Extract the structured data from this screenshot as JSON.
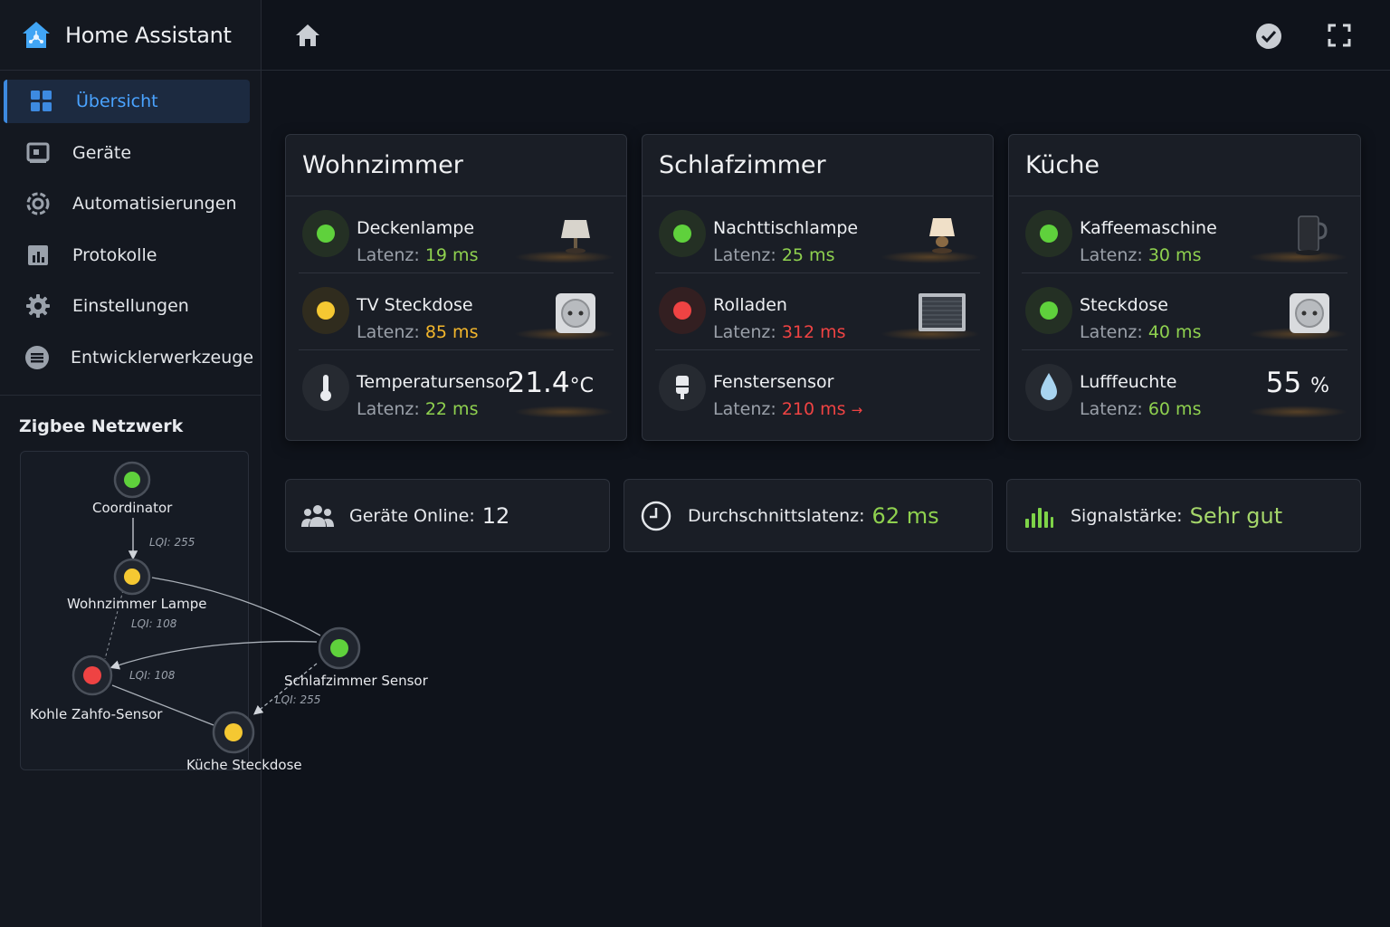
{
  "app": {
    "title": "Home Assistant"
  },
  "sidebar": {
    "items": [
      {
        "label": "Übersicht",
        "icon": "grid-icon",
        "active": true
      },
      {
        "label": "Geräte",
        "icon": "device-icon"
      },
      {
        "label": "Automatisierungen",
        "icon": "automation-icon"
      },
      {
        "label": "Protokolle",
        "icon": "log-icon"
      },
      {
        "label": "Einstellungen",
        "icon": "gear-icon"
      },
      {
        "label": "Entwicklerwerkzeuge",
        "icon": "developer-icon"
      }
    ]
  },
  "zigbee": {
    "title": "Zigbee Netzwerk",
    "nodes": [
      {
        "label": "Coordinator",
        "status": "green"
      },
      {
        "label": "Wohnzimmer Lampe",
        "status": "yellow"
      },
      {
        "label": "Schlafzimmer Sensor",
        "status": "green"
      },
      {
        "label": "Kohle Zahfo-Sensor",
        "status": "red"
      },
      {
        "label": "Küche Steckdose",
        "status": "yellow"
      }
    ],
    "links": [
      {
        "label": "LQI: 255"
      },
      {
        "label": "LQI: 108"
      },
      {
        "label": "LQI: 108"
      },
      {
        "label": "LQI: 255"
      }
    ]
  },
  "rooms": [
    {
      "title": "Wohnzimmer",
      "devices": [
        {
          "name": "Deckenlampe",
          "latency_label": "Latenz:",
          "latency": "19 ms",
          "status": "green",
          "icon": "ceiling-lamp-icon"
        },
        {
          "name": "TV Steckdose",
          "latency_label": "Latenz:",
          "latency": "85 ms",
          "status": "yellow",
          "icon": "socket-icon"
        },
        {
          "name": "Temperatursensor",
          "latency_label": "Latenz:",
          "latency": "22 ms",
          "status": "sensor",
          "icon": "thermometer-icon",
          "value": "21.4",
          "unit": "°C"
        }
      ]
    },
    {
      "title": "Schlafzimmer",
      "devices": [
        {
          "name": "Nachttischlampe",
          "latency_label": "Latenz:",
          "latency": "25 ms",
          "status": "green",
          "icon": "table-lamp-icon"
        },
        {
          "name": "Rolladen",
          "latency_label": "Latenz:",
          "latency": "312 ms",
          "status": "red",
          "icon": "shutter-icon"
        },
        {
          "name": "Fenstersensor",
          "latency_label": "Latenz:",
          "latency": "210 ms",
          "status": "sensor",
          "icon": "window-sensor-icon",
          "arrow": "→"
        }
      ]
    },
    {
      "title": "Küche",
      "devices": [
        {
          "name": "Kaffeemaschine",
          "latency_label": "Latenz:",
          "latency": "30 ms",
          "status": "green",
          "icon": "coffee-machine-icon"
        },
        {
          "name": "Steckdose",
          "latency_label": "Latenz:",
          "latency": "40 ms",
          "status": "green",
          "icon": "socket-icon"
        },
        {
          "name": "Lufffeuchte",
          "latency_label": "Latenz:",
          "latency": "60 ms",
          "status": "sensor",
          "icon": "droplet-icon",
          "value": "55",
          "unit": "%"
        }
      ]
    }
  ],
  "stats": [
    {
      "label": "Geräte Online:",
      "value": "12",
      "icon": "users-icon"
    },
    {
      "label": "Durchschnittslatenz:",
      "value": "62 ms",
      "icon": "clock-icon"
    },
    {
      "label": "Signalstärke:",
      "value": "Sehr gut",
      "icon": "signal-bars-icon"
    }
  ],
  "colors": {
    "accent": "#3d8ae0",
    "green": "#5fd13c",
    "yellow": "#f5c832",
    "red": "#ef4343",
    "latency_good": "#8fd14f",
    "latency_warn": "#f2b62c",
    "latency_bad": "#ef4343"
  }
}
